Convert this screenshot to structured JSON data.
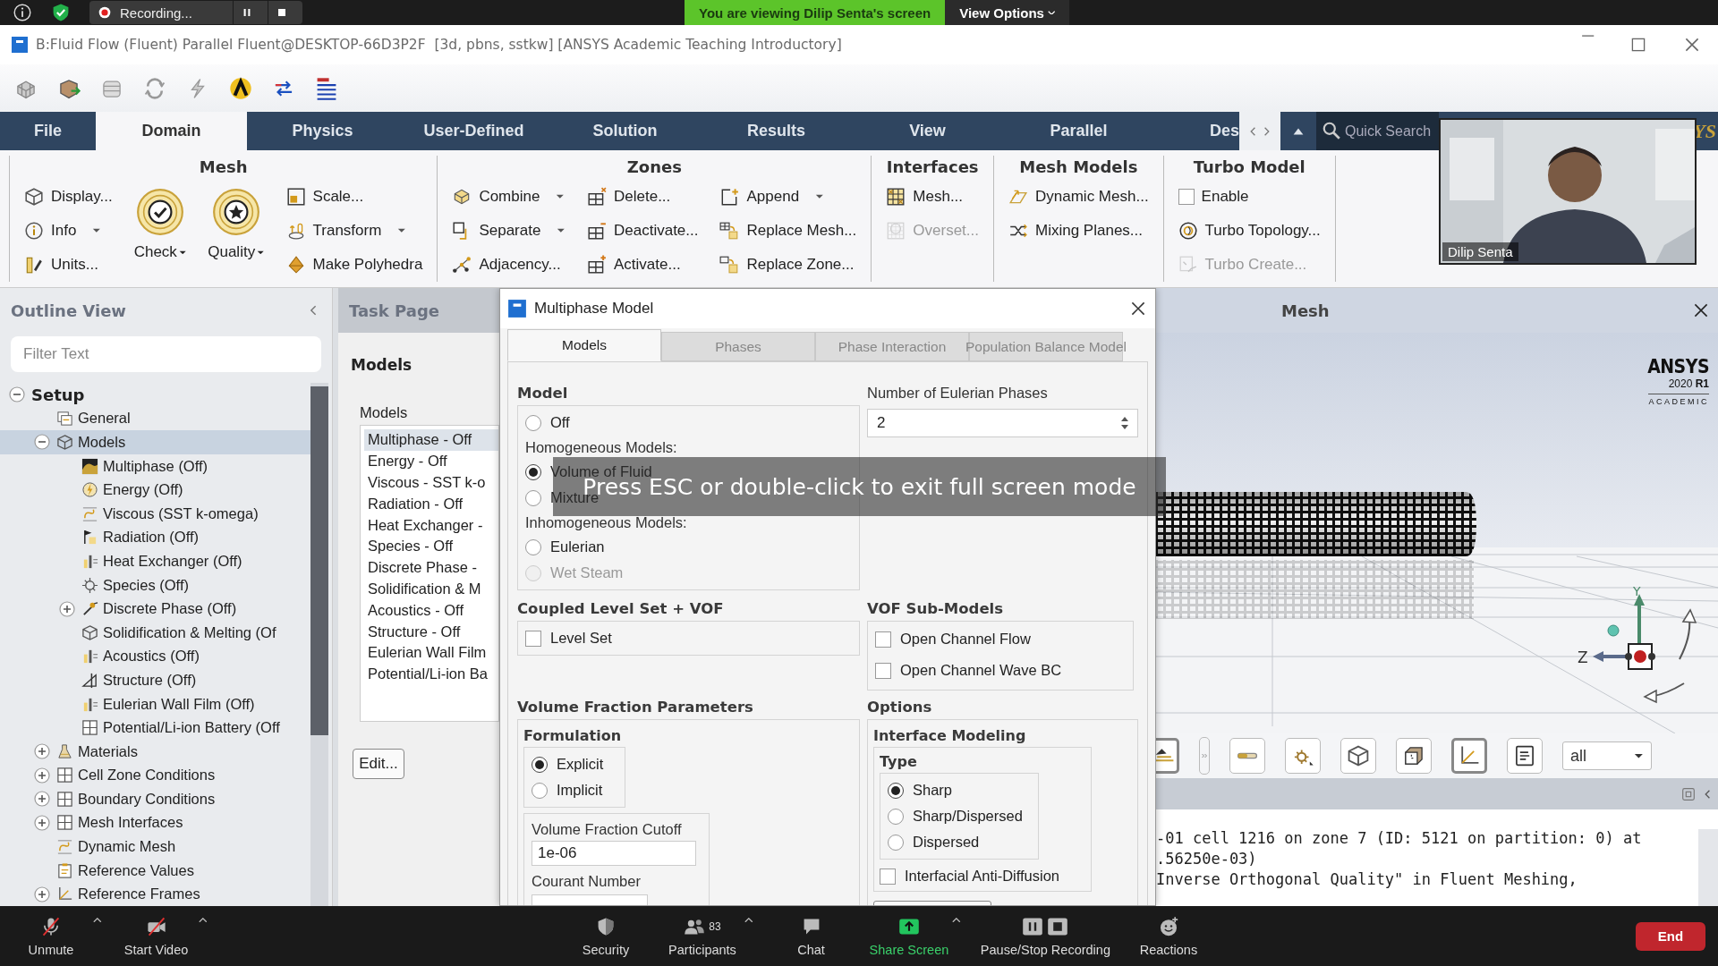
{
  "zoom_top": {
    "recording": "Recording...",
    "banner": "You are viewing Dilip Senta's screen",
    "view_options": "View Options"
  },
  "window": {
    "title": "B:Fluid Flow (Fluent) Parallel Fluent@DESKTOP-66D3P2F  [3d, pbns, sstkw] [ANSYS Academic Teaching Introductory]"
  },
  "ribbon_tabs": [
    {
      "label": "File",
      "selected": false
    },
    {
      "label": "Domain",
      "selected": true
    },
    {
      "label": "Physics",
      "selected": false
    },
    {
      "label": "User-Defined",
      "selected": false
    },
    {
      "label": "Solution",
      "selected": false
    },
    {
      "label": "Results",
      "selected": false
    },
    {
      "label": "View",
      "selected": false
    },
    {
      "label": "Parallel",
      "selected": false
    },
    {
      "label": "Des",
      "selected": false
    }
  ],
  "quick_search": {
    "placeholder": "Quick Search"
  },
  "brand_fragment": "YS",
  "ribbon_groups": [
    {
      "title": "Mesh",
      "columns": [
        [
          {
            "label": "Display...",
            "kind": "button",
            "disabled": false
          },
          {
            "label": "Info",
            "kind": "dropdown",
            "disabled": false
          },
          {
            "label": "Units...",
            "kind": "button",
            "disabled": false
          }
        ],
        [
          {
            "label": "Check",
            "kind": "big_dropdown",
            "disabled": false
          }
        ],
        [
          {
            "label": "Quality",
            "kind": "big_dropdown",
            "disabled": false
          }
        ],
        [
          {
            "label": "Scale...",
            "kind": "button",
            "disabled": false
          },
          {
            "label": "Transform",
            "kind": "dropdown",
            "disabled": false
          },
          {
            "label": "Make Polyhedra",
            "kind": "button",
            "disabled": false
          }
        ]
      ]
    },
    {
      "title": "Zones",
      "columns": [
        [
          {
            "label": "Combine",
            "kind": "dropdown",
            "disabled": false
          },
          {
            "label": "Separate",
            "kind": "dropdown",
            "disabled": false
          },
          {
            "label": "Adjacency...",
            "kind": "button",
            "disabled": false
          }
        ],
        [
          {
            "label": "Delete...",
            "kind": "button",
            "disabled": false
          },
          {
            "label": "Deactivate...",
            "kind": "button",
            "disabled": false
          },
          {
            "label": "Activate...",
            "kind": "button",
            "disabled": false
          }
        ],
        [
          {
            "label": "Append",
            "kind": "dropdown",
            "disabled": false
          },
          {
            "label": "Replace Mesh...",
            "kind": "button",
            "disabled": false
          },
          {
            "label": "Replace Zone...",
            "kind": "button",
            "disabled": false
          }
        ]
      ]
    },
    {
      "title": "Interfaces",
      "columns": [
        [
          {
            "label": "Mesh...",
            "kind": "button",
            "disabled": false
          },
          {
            "label": "Overset...",
            "kind": "button",
            "disabled": true
          }
        ]
      ]
    },
    {
      "title": "Mesh Models",
      "columns": [
        [
          {
            "label": "Dynamic Mesh...",
            "kind": "button",
            "disabled": false
          },
          {
            "label": "Mixing Planes...",
            "kind": "button",
            "disabled": false
          }
        ]
      ]
    },
    {
      "title": "Turbo Model",
      "columns": [
        [
          {
            "label": "Enable",
            "kind": "checkbox",
            "checked": false,
            "disabled": false
          },
          {
            "label": "Turbo Topology...",
            "kind": "button",
            "disabled": false
          },
          {
            "label": "Turbo Create...",
            "kind": "button",
            "disabled": true
          }
        ]
      ]
    }
  ],
  "webcam": {
    "name": "Dilip Senta"
  },
  "outline": {
    "title": "Outline View",
    "filter_placeholder": "Filter Text",
    "tree": [
      {
        "label": "Setup",
        "expanded": true,
        "selected": false,
        "children": [
          {
            "label": "General",
            "selected": false
          },
          {
            "label": "Models",
            "expanded": true,
            "selected": true,
            "children": [
              {
                "label": "Multiphase (Off)",
                "selected": false
              },
              {
                "label": "Energy (Off)",
                "selected": false
              },
              {
                "label": "Viscous (SST k-omega)",
                "selected": false
              },
              {
                "label": "Radiation (Off)",
                "selected": false
              },
              {
                "label": "Heat Exchanger (Off)",
                "selected": false
              },
              {
                "label": "Species (Off)",
                "selected": false
              },
              {
                "label": "Discrete Phase (Off)",
                "expanded": false,
                "selected": false
              },
              {
                "label": "Solidification & Melting (Of",
                "selected": false
              },
              {
                "label": "Acoustics (Off)",
                "selected": false
              },
              {
                "label": "Structure (Off)",
                "selected": false
              },
              {
                "label": "Eulerian Wall Film (Off)",
                "selected": false
              },
              {
                "label": "Potential/Li-ion Battery (Off",
                "selected": false
              }
            ]
          },
          {
            "label": "Materials",
            "expanded": false,
            "selected": false
          },
          {
            "label": "Cell Zone Conditions",
            "expanded": false,
            "selected": false
          },
          {
            "label": "Boundary Conditions",
            "expanded": false,
            "selected": false
          },
          {
            "label": "Mesh Interfaces",
            "expanded": false,
            "selected": false
          },
          {
            "label": "Dynamic Mesh",
            "selected": false
          },
          {
            "label": "Reference Values",
            "selected": false
          },
          {
            "label": "Reference Frames",
            "expanded": false,
            "selected": false
          }
        ]
      }
    ]
  },
  "task_page": {
    "title": "Task Page",
    "heading": "Models",
    "list_label": "Models",
    "models": [
      {
        "label": "Multiphase - Off",
        "selected": true
      },
      {
        "label": "Energy - Off",
        "selected": false
      },
      {
        "label": "Viscous - SST k-o",
        "selected": false
      },
      {
        "label": "Radiation - Off",
        "selected": false
      },
      {
        "label": "Heat Exchanger -",
        "selected": false
      },
      {
        "label": "Species - Off",
        "selected": false
      },
      {
        "label": "Discrete Phase -",
        "selected": false
      },
      {
        "label": "Solidification & M",
        "selected": false
      },
      {
        "label": "Acoustics - Off",
        "selected": false
      },
      {
        "label": "Structure - Off",
        "selected": false
      },
      {
        "label": "Eulerian Wall Film",
        "selected": false
      },
      {
        "label": "Potential/Li-ion Ba",
        "selected": false
      }
    ],
    "edit_button": "Edit..."
  },
  "dialog": {
    "title": "Multiphase Model",
    "tabs": [
      {
        "label": "Models",
        "selected": true
      },
      {
        "label": "Phases",
        "selected": false
      },
      {
        "label": "Phase Interaction",
        "selected": false
      },
      {
        "label": "Population Balance Model",
        "selected": false
      }
    ],
    "model": {
      "title": "Model",
      "options": [
        {
          "label": "Off",
          "selected": false,
          "disabled": false
        }
      ],
      "groups": [
        {
          "heading": "Homogeneous Models:",
          "options": [
            {
              "label": "Volume of Fluid",
              "selected": true,
              "disabled": false
            },
            {
              "label": "Mixture",
              "selected": false,
              "disabled": false
            }
          ]
        },
        {
          "heading": "Inhomogeneous Models:",
          "options": [
            {
              "label": "Eulerian",
              "selected": false,
              "disabled": false
            },
            {
              "label": "Wet Steam",
              "selected": false,
              "disabled": true
            }
          ]
        }
      ]
    },
    "eulerian_phases": {
      "label": "Number of Eulerian Phases",
      "value": "2"
    },
    "coupled_level_set": {
      "title": "Coupled Level Set + VOF",
      "options": [
        {
          "label": "Level Set",
          "checked": false
        }
      ]
    },
    "vof_sub_models": {
      "title": "VOF Sub-Models",
      "options": [
        {
          "label": "Open Channel Flow",
          "checked": false
        },
        {
          "label": "Open Channel Wave BC",
          "checked": false
        }
      ]
    },
    "volume_fraction": {
      "title": "Volume Fraction Parameters",
      "formulation": {
        "title": "Formulation",
        "options": [
          {
            "label": "Explicit",
            "selected": true
          },
          {
            "label": "Implicit",
            "selected": false
          }
        ]
      },
      "cutoff": {
        "label": "Volume Fraction Cutoff",
        "value": "1e-06"
      },
      "courant": {
        "label": "Courant Number"
      }
    },
    "options": {
      "title": "Options",
      "interface_modeling": {
        "title": "Interface Modeling",
        "type": {
          "title": "Type",
          "options": [
            {
              "label": "Sharp",
              "selected": true
            },
            {
              "label": "Sharp/Dispersed",
              "selected": false
            },
            {
              "label": "Dispersed",
              "selected": false
            }
          ]
        },
        "anti_diffusion": {
          "label": "Interfacial Anti-Diffusion",
          "checked": false
        }
      }
    }
  },
  "fullscreen_hint": "Press ESC or double-click to exit full screen mode",
  "mesh_panel": {
    "title": "Mesh",
    "logo": {
      "name": "ANSYS",
      "version": "2020 **R1**",
      "edition": "ACADEMIC"
    },
    "axes": {
      "y": "Y",
      "z": "Z"
    },
    "toolbar": {
      "buttons": [
        {
          "selected": true
        },
        {
          "selected": false
        },
        {
          "selected": false
        },
        {
          "selected": false
        },
        {
          "selected": false
        },
        {
          "selected": true
        },
        {
          "selected": false
        }
      ],
      "display_select": "all"
    },
    "console": {
      "lines": [
        "-01 cell 1216 on zone 7 (ID: 5121 on partition: 0) at",
        ".56250e-03)",
        "Inverse Orthogonal Quality\" in Fluent Meshing,"
      ]
    }
  },
  "meeting_controls": [
    {
      "label": "Unmute",
      "kind": "mic",
      "has_menu": true
    },
    {
      "label": "Start Video",
      "kind": "video",
      "has_menu": true
    },
    {
      "label": "Security",
      "kind": "security",
      "has_menu": false
    },
    {
      "label": "Participants",
      "kind": "participants",
      "count": "83",
      "has_menu": true
    },
    {
      "label": "Chat",
      "kind": "chat",
      "has_menu": false
    },
    {
      "label": "Share Screen",
      "kind": "share",
      "has_menu": true
    },
    {
      "label": "Pause/Stop Recording",
      "kind": "recording",
      "has_menu": false
    },
    {
      "label": "Reactions",
      "kind": "reactions",
      "has_menu": false
    }
  ],
  "end_button": "End"
}
